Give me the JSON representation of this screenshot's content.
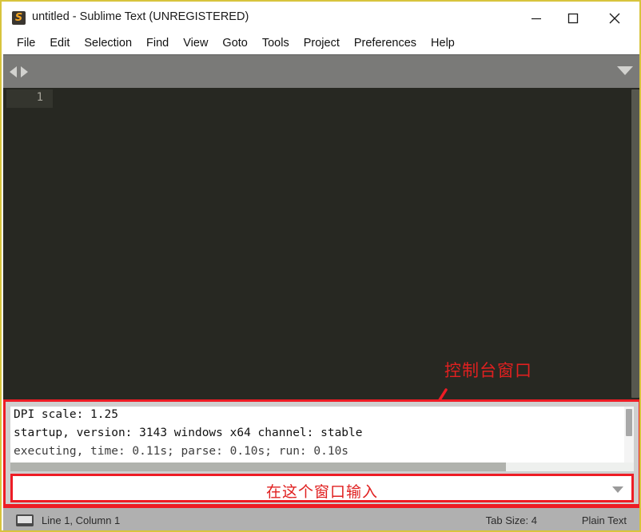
{
  "window": {
    "title": "untitled - Sublime Text (UNREGISTERED)",
    "app_icon": "sublime-text-icon",
    "border_color": "#d8c43c",
    "controls": {
      "minimize": "minimize-icon",
      "maximize": "maximize-icon",
      "close": "close-icon"
    }
  },
  "menubar": {
    "items": [
      {
        "label": "File"
      },
      {
        "label": "Edit"
      },
      {
        "label": "Selection"
      },
      {
        "label": "Find"
      },
      {
        "label": "View"
      },
      {
        "label": "Goto"
      },
      {
        "label": "Tools"
      },
      {
        "label": "Project"
      },
      {
        "label": "Preferences"
      },
      {
        "label": "Help"
      }
    ]
  },
  "tabbar": {
    "prev_icon": "triangle-left-icon",
    "next_icon": "triangle-right-icon",
    "menu_icon": "chevron-down-icon"
  },
  "editor": {
    "background": "#272822",
    "line_numbers": [
      "1"
    ],
    "content": ""
  },
  "annotations": {
    "console_label": "控制台窗口",
    "input_label": "在这个窗口输入",
    "color": "#e02020",
    "box_color": "#ee1c25"
  },
  "console": {
    "lines": [
      "DPI scale: 1.25",
      "startup, version: 3143 windows x64 channel: stable",
      "executing, time: 0.11s; parse: 0.10s; run: 0.10s"
    ],
    "input_value": "",
    "dropdown_icon": "chevron-down-icon"
  },
  "statusbar": {
    "icon": "monitor-icon",
    "position": "Line 1, Column 1",
    "tab_size": "Tab Size: 4",
    "syntax": "Plain Text"
  }
}
